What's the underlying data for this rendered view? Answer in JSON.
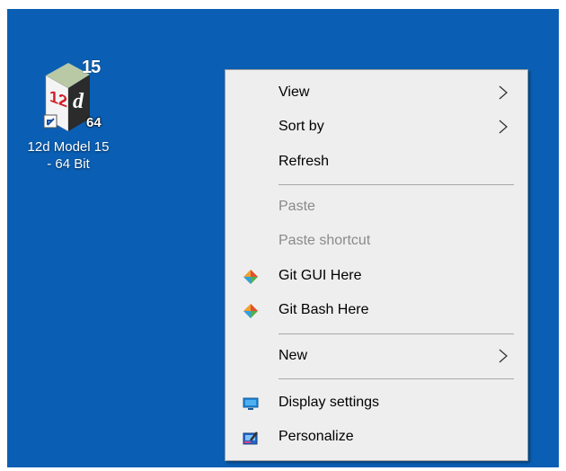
{
  "desktop": {
    "background_color": "#0a5fb4",
    "icon": {
      "name": "12d-model-15-icon",
      "label_line1": "12d Model 15",
      "label_line2": "- 64 Bit",
      "badge_version": "15",
      "badge_arch": "64",
      "logo_text_12": "12",
      "logo_text_d": "d"
    }
  },
  "context_menu": {
    "items": [
      {
        "label": "View",
        "submenu": true,
        "enabled": true
      },
      {
        "label": "Sort by",
        "submenu": true,
        "enabled": true
      },
      {
        "label": "Refresh",
        "submenu": false,
        "enabled": true
      },
      {
        "label": "Paste",
        "submenu": false,
        "enabled": false
      },
      {
        "label": "Paste shortcut",
        "submenu": false,
        "enabled": false
      },
      {
        "label": "Git GUI Here",
        "submenu": false,
        "enabled": true,
        "icon": "git-icon"
      },
      {
        "label": "Git Bash Here",
        "submenu": false,
        "enabled": true,
        "icon": "git-icon"
      },
      {
        "label": "New",
        "submenu": true,
        "enabled": true
      },
      {
        "label": "Display settings",
        "submenu": false,
        "enabled": true,
        "icon": "monitor-icon"
      },
      {
        "label": "Personalize",
        "submenu": false,
        "enabled": true,
        "icon": "personalize-icon"
      }
    ]
  }
}
